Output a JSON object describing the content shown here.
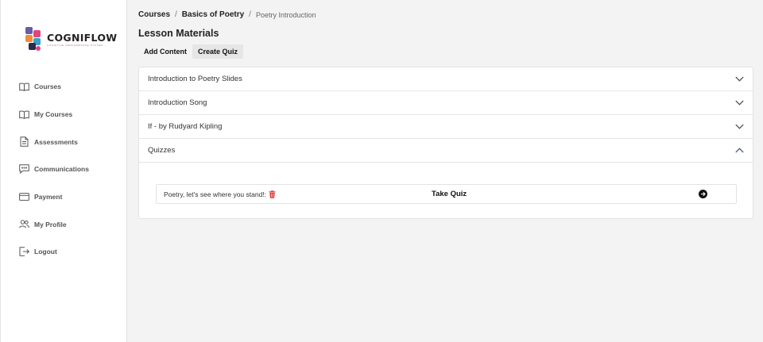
{
  "brand": {
    "name": "COGNIFLOW",
    "tagline": "COGNITIVE PERFORMANCE SYSTEM"
  },
  "sidebar": {
    "items": [
      {
        "label": "Courses",
        "icon": "book-open-icon"
      },
      {
        "label": "My Courses",
        "icon": "book-open-icon"
      },
      {
        "label": "Assessments",
        "icon": "document-icon"
      },
      {
        "label": "Communications",
        "icon": "chat-icon"
      },
      {
        "label": "Payment",
        "icon": "credit-card-icon"
      },
      {
        "label": "My Profile",
        "icon": "users-icon"
      },
      {
        "label": "Logout",
        "icon": "logout-icon"
      }
    ]
  },
  "breadcrumb": {
    "root": "Courses",
    "course": "Basics of Poetry",
    "current": "Poetry Introduction",
    "separator": "/"
  },
  "page": {
    "title": "Lesson Materials"
  },
  "actions": {
    "add_content": "Add Content",
    "create_quiz": "Create Quiz"
  },
  "sections": [
    {
      "title": "Introduction to Poetry Slides",
      "expanded": false
    },
    {
      "title": "Introduction Song",
      "expanded": false
    },
    {
      "title": "If - by Rudyard Kipling",
      "expanded": false
    },
    {
      "title": "Quizzes",
      "expanded": true
    }
  ],
  "quiz": {
    "name": "Poetry, let's see where you stand!:",
    "take_label": "Take Quiz"
  },
  "colors": {
    "trash": "#e03b3b",
    "chevron_active": "#3b4a7a",
    "sidebar_bg": "#ffffff",
    "content_bg": "#f3f3f3"
  }
}
